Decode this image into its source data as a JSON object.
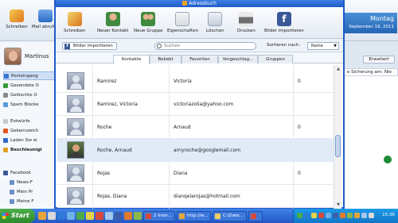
{
  "background_app": {
    "toolbar": [
      "Schreiben",
      "Mail abrufen"
    ],
    "user_name": "Martinus",
    "nav": [
      "Posteingang",
      "Gesendete O",
      "Gelöschte O",
      "Spam Blocke",
      "Entwürfe",
      "Gekennzeich",
      "Laden Sie ei",
      "Beschleunigi",
      "Facebook",
      "News-F",
      "Mein Pr",
      "Meine F"
    ],
    "date_day": "Montag",
    "date_full": "September 19, 2011",
    "button_right": "Erweitert",
    "security_text": "e Sicherung am: Nie"
  },
  "window": {
    "title": "Adressbuch",
    "toolbar": [
      "Schreiben",
      "Neuer Kontakt",
      "Neue Gruppe",
      "Eigenschaften",
      "Löschen",
      "Drucken",
      "Bilder importieren"
    ],
    "import_button": "Bilder importieren",
    "search_placeholder": "Suchen",
    "sort_label": "Sortieren nach:",
    "sort_value": "Name",
    "tabs": [
      "Kontakte",
      "Beliebt",
      "Favoriten",
      "Vorgeschlag...",
      "Gruppen"
    ],
    "contacts": [
      {
        "name": "Ramirez",
        "email": "Victoria",
        "count": "0"
      },
      {
        "name": "Ramirez, Victoria",
        "email": "victoriazolia@yahoo.com",
        "count": ""
      },
      {
        "name": "Roche",
        "email": "Arnaud",
        "count": "0"
      },
      {
        "name": "Roche, Arnaud",
        "email": "arnyroche@googlemail.com",
        "count": ""
      },
      {
        "name": "Rojas",
        "email": "Diana",
        "count": "0"
      },
      {
        "name": "Rojas, Diana",
        "email": "dianqelarojas@hotmail.com",
        "count": ""
      }
    ]
  },
  "taskbar": {
    "start": "Start",
    "tasks": [
      "2 Inter...",
      "http://w...",
      "C:\\Date...",
      ""
    ],
    "clock": "15:36"
  }
}
